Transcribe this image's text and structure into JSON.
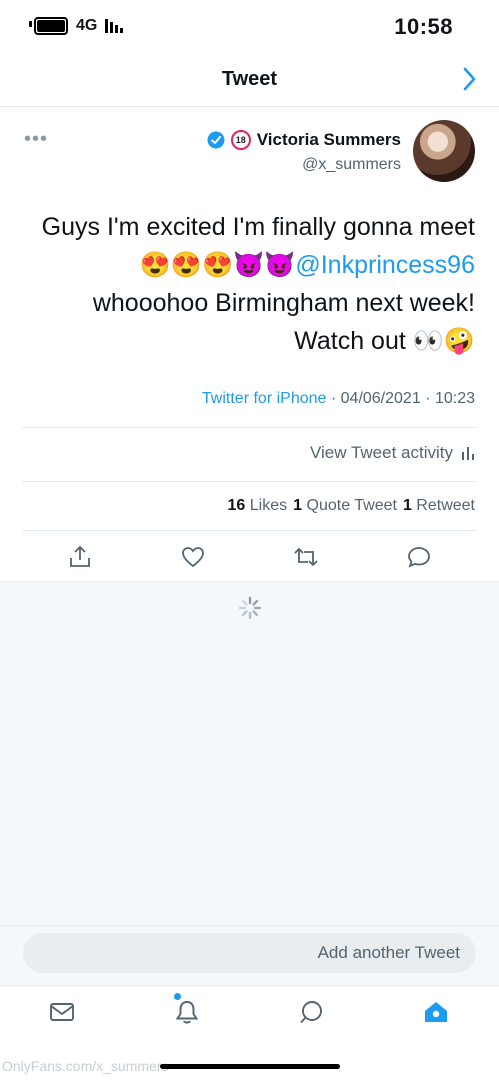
{
  "status": {
    "time": "10:58",
    "network": "4G"
  },
  "nav": {
    "title": "Tweet",
    "back_icon": "chevron-back-icon"
  },
  "author": {
    "name": "Victoria Summers",
    "age_badge": "18",
    "handle": "@x_summers"
  },
  "tweet": {
    "line1": "Guys I'm excited I'm finally gonna meet",
    "mention": "@Inkprincess96",
    "mention_emojis": "😍😍😍😈😈",
    "line3": "whooohoo Birmingham next week!",
    "line4": "Watch out 👀🤪"
  },
  "meta": {
    "time": "10:23",
    "date": "04/06/2021",
    "source": "Twitter for iPhone"
  },
  "activity": {
    "label": "View Tweet activity"
  },
  "stats": {
    "retweets": "1",
    "retweets_label": "Retweet",
    "quotes": "1",
    "quotes_label": "Quote Tweet",
    "likes": "16",
    "likes_label": "Likes"
  },
  "compose": {
    "placeholder": "Add another Tweet"
  },
  "watermark": "OnlyFans.com/x_summers",
  "colors": {
    "accent": "#1d9bf0",
    "muted": "#536471",
    "background_gray": "#f5f8fa"
  }
}
